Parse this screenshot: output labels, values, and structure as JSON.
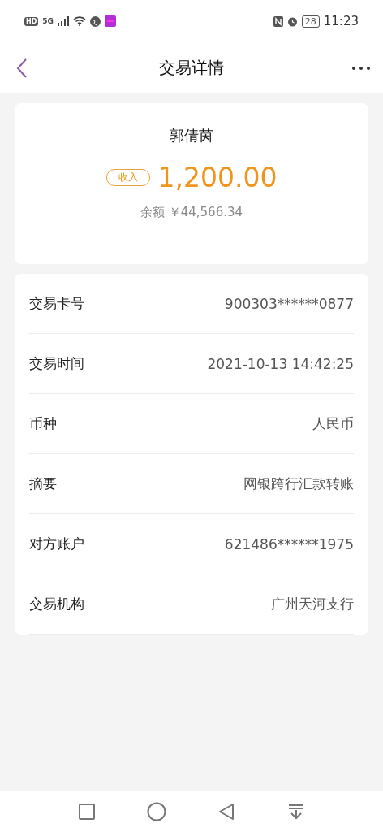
{
  "status_bar": {
    "network_hd": "HD",
    "network_type": "5G",
    "battery": "28",
    "time": "11:23"
  },
  "header": {
    "title": "交易详情"
  },
  "summary": {
    "name": "郭倩茵",
    "tag": "收入",
    "amount": "1,200.00",
    "balance_label": "余额",
    "balance": "￥44,566.34"
  },
  "details": [
    {
      "label": "交易卡号",
      "value": "900303******0877"
    },
    {
      "label": "交易时间",
      "value": "2021-10-13 14:42:25"
    },
    {
      "label": "币种",
      "value": "人民币"
    },
    {
      "label": "摘要",
      "value": "网银跨行汇款转账"
    },
    {
      "label": "对方账户",
      "value": "621486******1975"
    },
    {
      "label": "交易机构",
      "value": "广州天河支行"
    }
  ]
}
